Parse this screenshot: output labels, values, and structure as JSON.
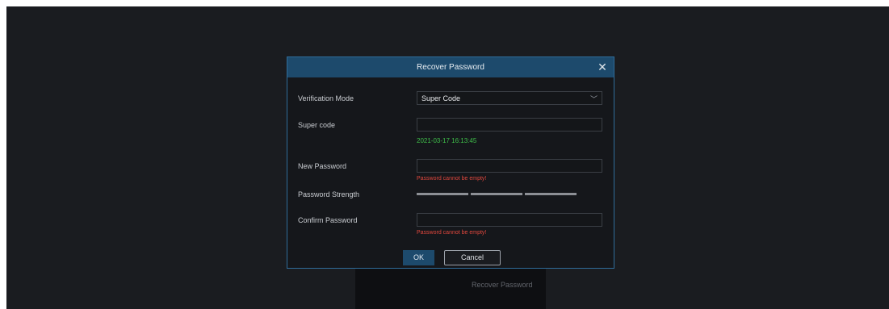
{
  "background_link": "Recover Password",
  "dialog": {
    "title": "Recover Password",
    "close_icon": "close-icon",
    "verification_mode": {
      "label": "Verification Mode",
      "value": "Super Code"
    },
    "super_code": {
      "label": "Super code",
      "value": "",
      "timestamp": "2021-03-17 16:13:45"
    },
    "new_password": {
      "label": "New Password",
      "value": "",
      "error": "Password cannot be empty!"
    },
    "password_strength": {
      "label": "Password Strength"
    },
    "confirm_password": {
      "label": "Confirm Password",
      "value": "",
      "error": "Password cannot be empty!"
    },
    "ok_label": "OK",
    "cancel_label": "Cancel"
  },
  "colors": {
    "accent": "#1d4a6c",
    "success": "#3fbf4a",
    "error": "#e0473d"
  }
}
